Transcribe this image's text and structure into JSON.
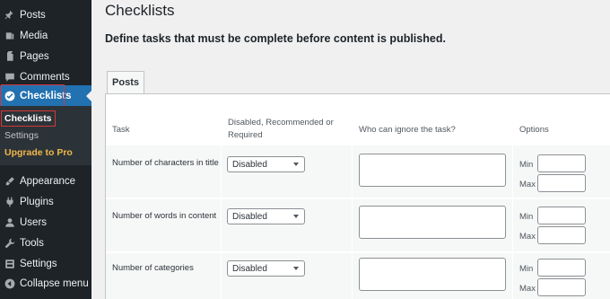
{
  "sidebar": {
    "items": [
      {
        "label": "Posts",
        "icon": "pin-icon"
      },
      {
        "label": "Media",
        "icon": "media-icon"
      },
      {
        "label": "Pages",
        "icon": "pages-icon"
      },
      {
        "label": "Comments",
        "icon": "comments-icon"
      },
      {
        "label": "Checklists",
        "icon": "checkmark-icon"
      },
      {
        "label": "Appearance",
        "icon": "brush-icon"
      },
      {
        "label": "Plugins",
        "icon": "plugin-icon"
      },
      {
        "label": "Users",
        "icon": "users-icon"
      },
      {
        "label": "Tools",
        "icon": "wrench-icon"
      },
      {
        "label": "Settings",
        "icon": "settings-icon"
      },
      {
        "label": "Collapse menu",
        "icon": "collapse-icon"
      }
    ],
    "submenu": {
      "checklists": "Checklists",
      "settings": "Settings",
      "upgrade": "Upgrade to Pro"
    }
  },
  "page": {
    "title": "Checklists",
    "description": "Define tasks that must be complete before content is published."
  },
  "tabs": [
    "Posts"
  ],
  "table": {
    "headers": {
      "task": "Task",
      "status": "Disabled, Recommended or Required",
      "ignore": "Who can ignore the task?",
      "options": "Options"
    },
    "rows": [
      {
        "task": "Number of characters in title",
        "status": "Disabled"
      },
      {
        "task": "Number of words in content",
        "status": "Disabled"
      },
      {
        "task": "Number of categories",
        "status": "Disabled"
      }
    ],
    "option_labels": {
      "min": "Min",
      "max": "Max"
    }
  },
  "colors": {
    "sidebar_bg": "#1d2327",
    "active_bg": "#2271b1",
    "highlight_border": "#d63638",
    "upgrade_text": "#f0b849"
  }
}
